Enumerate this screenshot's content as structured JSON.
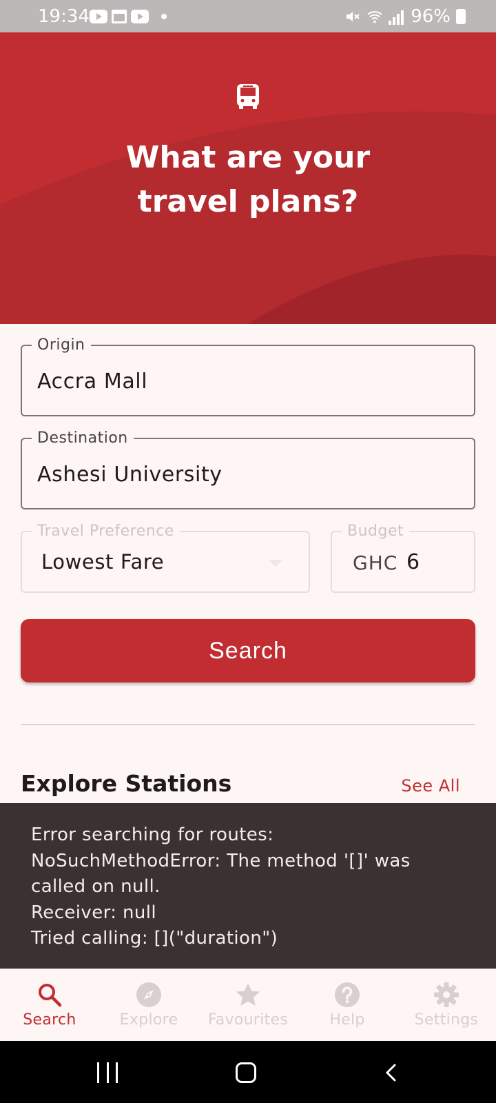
{
  "status_bar": {
    "time": "19:34",
    "battery": "96%",
    "icons": [
      "youtube-icon",
      "calendar-icon",
      "youtube-icon",
      "dot-icon",
      "mute-icon",
      "wifi-icon",
      "signal-icon",
      "battery-icon"
    ]
  },
  "header": {
    "title_line1": "What are your",
    "title_line2": "travel plans?",
    "icon": "bus-icon",
    "color": "#c22d32"
  },
  "form": {
    "origin": {
      "label": "Origin",
      "value": "Accra Mall"
    },
    "destination": {
      "label": "Destination",
      "value": "Ashesi University"
    },
    "travel_preference": {
      "label": "Travel Preference",
      "value": "Lowest Fare"
    },
    "budget": {
      "label": "Budget",
      "prefix": "GHC",
      "value": "6"
    },
    "search_button": "Search"
  },
  "explore": {
    "title": "Explore Stations",
    "see_all": "See All"
  },
  "snackbar": {
    "lines": [
      "Error searching for routes:",
      "NoSuchMethodError: The method '[]' was",
      "called on null.",
      "Receiver: null",
      "Tried calling: [](\"duration\")"
    ]
  },
  "bottom_nav": {
    "items": [
      {
        "label": "Search",
        "icon": "search-icon",
        "active": true
      },
      {
        "label": "Explore",
        "icon": "compass-icon",
        "active": false
      },
      {
        "label": "Favourites",
        "icon": "star-icon",
        "active": false
      },
      {
        "label": "Help",
        "icon": "help-icon",
        "active": false
      },
      {
        "label": "Settings",
        "icon": "gear-icon",
        "active": false
      }
    ]
  },
  "colors": {
    "primary": "#c22d32",
    "background": "#fdf6f5",
    "snackbar": "#3a3131"
  }
}
